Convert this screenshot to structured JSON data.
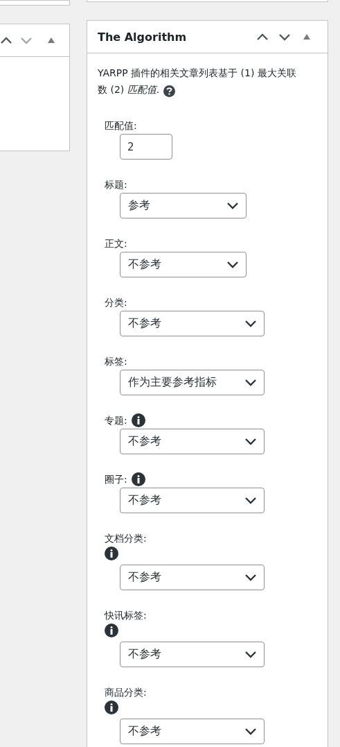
{
  "right_panel": {
    "title": "The Algorithm",
    "description": "YARPP 插件的相关文章列表基于 (1) 最大关联数 (2) *匹配值*.",
    "match_field": {
      "label": "匹配值:",
      "value": "2"
    },
    "fields": [
      {
        "kind": "plain",
        "label": "标题:",
        "value": "参考",
        "wide": false
      },
      {
        "kind": "plain",
        "label": "正文:",
        "value": "不参考",
        "wide": false
      },
      {
        "kind": "plain",
        "label": "分类:",
        "value": "不参考",
        "wide": true
      },
      {
        "kind": "plain",
        "label": "标签:",
        "value": "作为主要参考指标",
        "wide": true
      },
      {
        "kind": "inline_info",
        "label": "专题:",
        "value": "不参考",
        "wide": true
      },
      {
        "kind": "inline_info",
        "label": "圈子:",
        "value": "不参考",
        "wide": true
      },
      {
        "kind": "below_info",
        "label": "文档分类:",
        "value": "不参考",
        "wide": true
      },
      {
        "kind": "below_info",
        "label": "快讯标签:",
        "value": "不参考",
        "wide": true
      },
      {
        "kind": "below_info",
        "label": "商品分类:",
        "value": "不参考",
        "wide": true
      }
    ]
  }
}
